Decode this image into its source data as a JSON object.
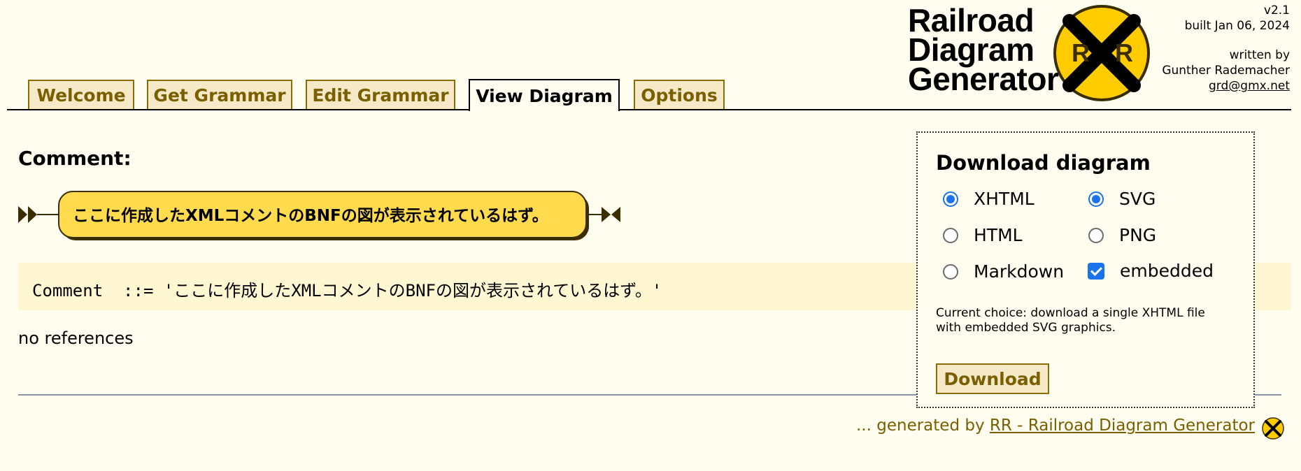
{
  "header": {
    "version": "v2.1",
    "built": "built Jan 06, 2024",
    "written_by": "written by",
    "author_name": "Gunther Rademacher",
    "author_email": "grd@gmx.net",
    "logo_lines": [
      "Railroad",
      "Diagram",
      "Generator"
    ],
    "logo_sign_letters": [
      "R",
      "R"
    ]
  },
  "tabs": [
    {
      "label": "Welcome",
      "active": false
    },
    {
      "label": "Get Grammar",
      "active": false
    },
    {
      "label": "Edit Grammar",
      "active": false
    },
    {
      "label": "View Diagram",
      "active": true
    },
    {
      "label": "Options",
      "active": false
    }
  ],
  "main": {
    "heading": "Comment:",
    "diagram_terminal": "ここに作成したXMLコメントのBNFの図が表示されているはず。",
    "ebnf": "Comment  ::= 'ここに作成したXMLコメントのBNFの図が表示されているはず。'",
    "references": "no references"
  },
  "download": {
    "title": "Download diagram",
    "options": {
      "xhtml": {
        "label": "XHTML",
        "selected": true
      },
      "html": {
        "label": "HTML",
        "selected": false
      },
      "markdown": {
        "label": "Markdown",
        "selected": false
      },
      "svg": {
        "label": "SVG",
        "selected": true
      },
      "png": {
        "label": "PNG",
        "selected": false
      },
      "embedded": {
        "label": "embedded",
        "checked": true
      }
    },
    "choice_text": "Current choice: download a single XHTML file with embedded SVG graphics.",
    "button_label": "Download"
  },
  "footer": {
    "prefix": "... generated by ",
    "link_text": "RR - Railroad Diagram Generator"
  },
  "colors": {
    "background": "#FFFCF0",
    "tab_bg": "#F5E9C7",
    "tab_text": "#7A5F00",
    "terminal_fill": "#FFDB4D",
    "ebnf_bg": "#FFF6D2",
    "accent_blue": "#1A73E8"
  }
}
